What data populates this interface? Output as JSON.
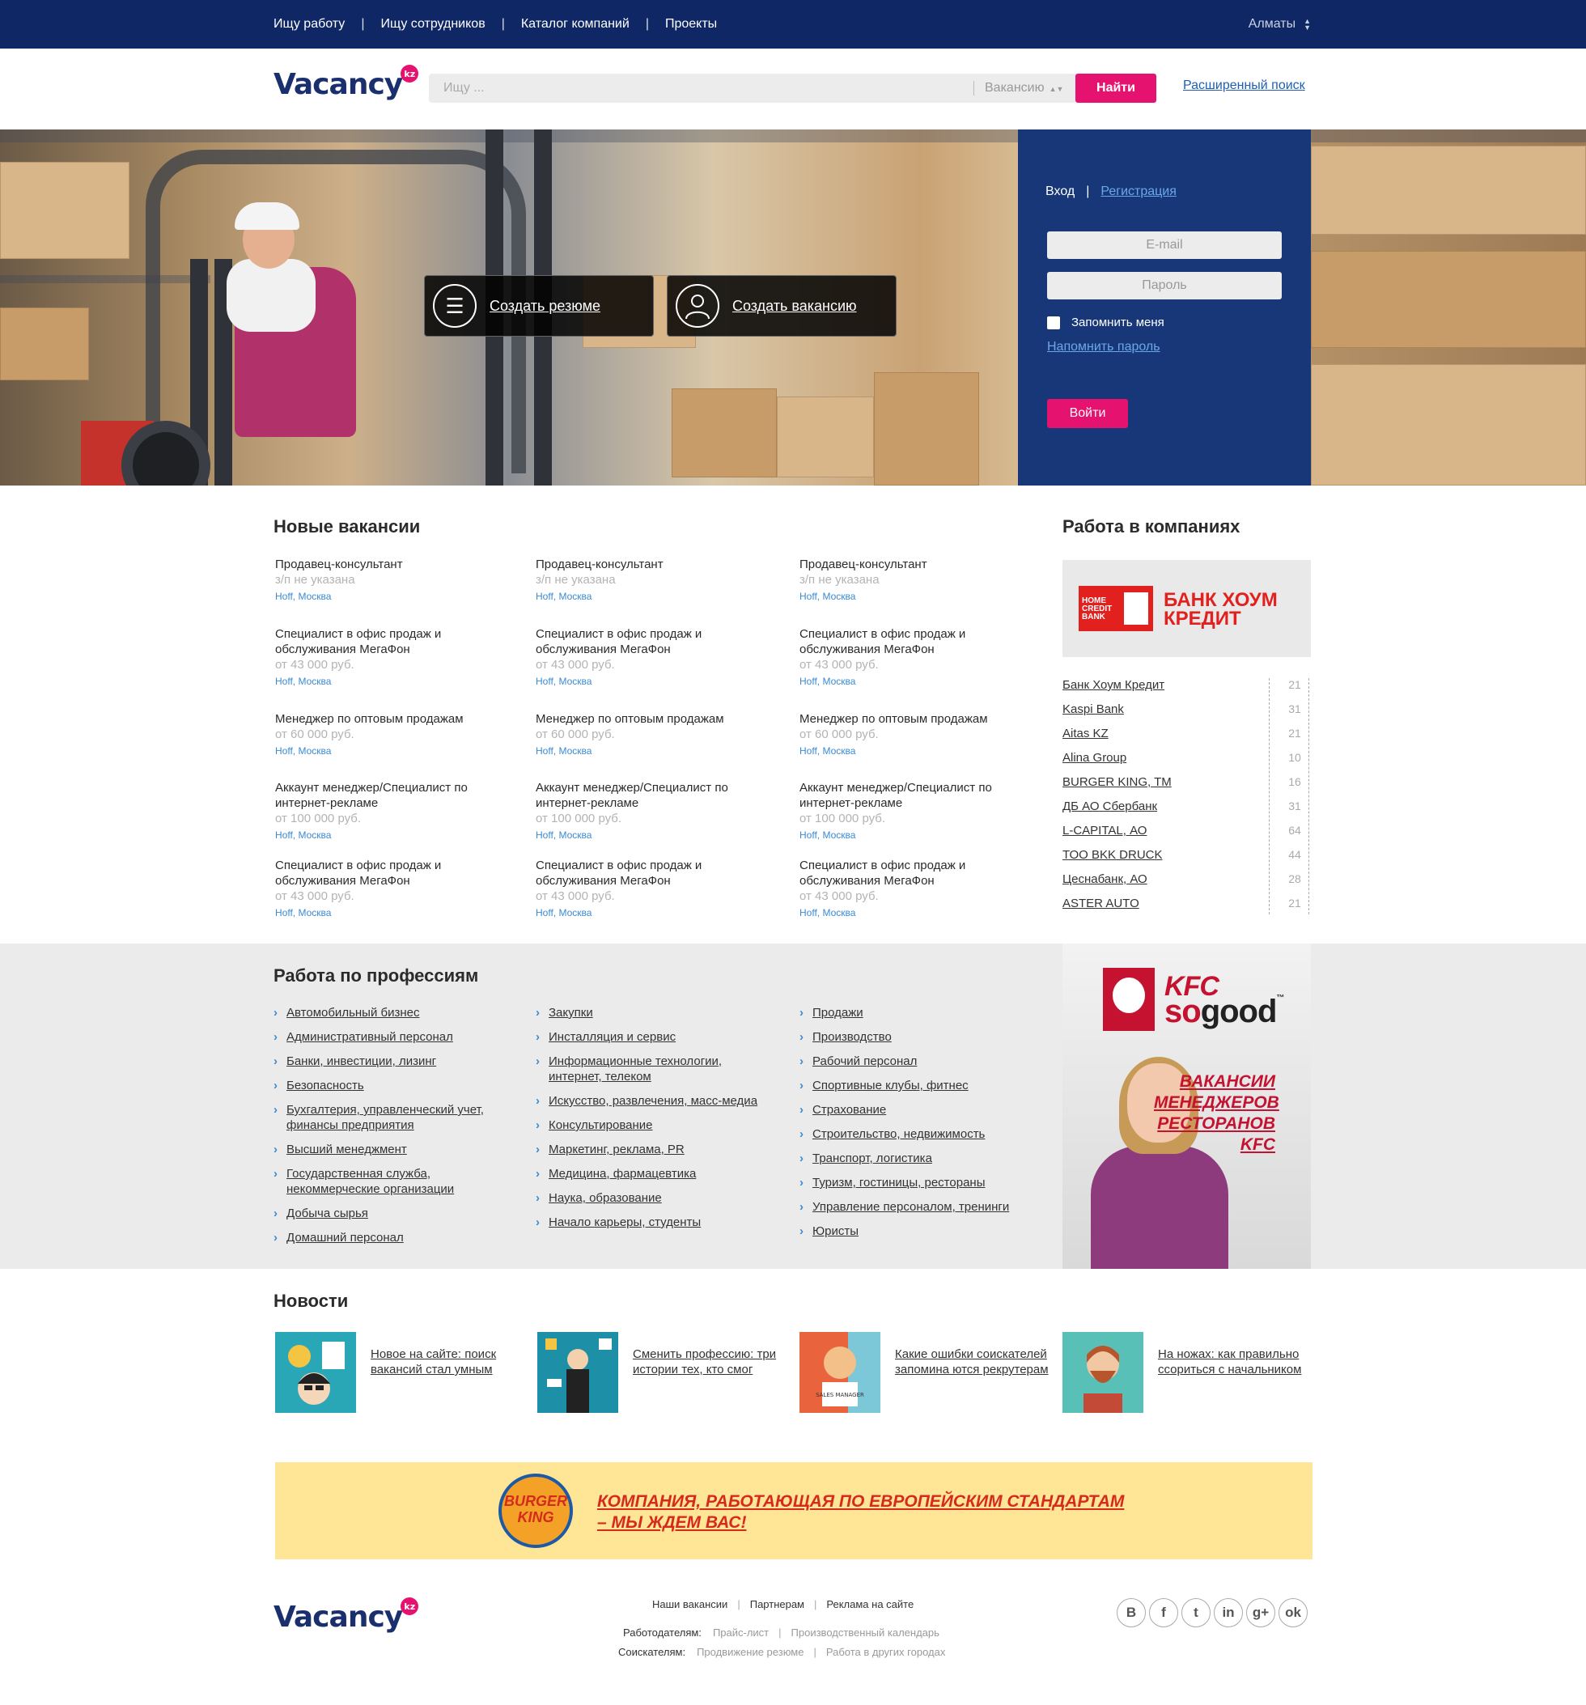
{
  "topnav": {
    "items": [
      "Ищу работу",
      "Ищу сотрудников",
      "Каталог компаний",
      "Проекты"
    ],
    "city": "Алматы"
  },
  "header": {
    "logo": "Vacancy",
    "logo_badge": "kz",
    "search_placeholder": "Ищу ...",
    "search_type": "Вакансию",
    "find_button": "Найти",
    "advanced_search": "Расширенный поиск"
  },
  "hero": {
    "create_resume": "Создать резюме",
    "create_vacancy": "Создать вакансию"
  },
  "login": {
    "tab_login": "Вход",
    "tab_register": "Регистрация",
    "email_placeholder": "E-mail",
    "password_placeholder": "Пароль",
    "remember": "Запомнить меня",
    "forgot": "Напомнить пароль",
    "submit": "Войти"
  },
  "vacancies": {
    "title": "Новые вакансии",
    "items": [
      {
        "title": "Продавец-консультант",
        "salary": "з/п не указана",
        "company": "Hoff, Москва"
      },
      {
        "title": "Продавец-консультант",
        "salary": "з/п не указана",
        "company": "Hoff, Москва"
      },
      {
        "title": "Продавец-консультант",
        "salary": "з/п не указана",
        "company": "Hoff, Москва"
      },
      {
        "title": "Специалист в офис продаж и обслуживания МегаФон",
        "salary": "от 43 000 руб.",
        "company": "Hoff, Москва"
      },
      {
        "title": "Специалист в офис продаж и обслуживания МегаФон",
        "salary": "от 43 000 руб.",
        "company": "Hoff, Москва"
      },
      {
        "title": "Специалист в офис продаж и обслуживания МегаФон",
        "salary": "от 43 000 руб.",
        "company": "Hoff, Москва"
      },
      {
        "title": "Менеджер по оптовым продажам",
        "salary": "от 60 000 руб.",
        "company": "Hoff, Москва"
      },
      {
        "title": "Менеджер по оптовым продажам",
        "salary": "от 60 000 руб.",
        "company": "Hoff, Москва"
      },
      {
        "title": "Менеджер по оптовым продажам",
        "salary": "от 60 000 руб.",
        "company": "Hoff, Москва"
      },
      {
        "title": "Аккаунт менеджер/Специалист по интернет-рекламе",
        "salary": "от 100 000 руб.",
        "company": "Hoff, Москва"
      },
      {
        "title": "Аккаунт менеджер/Специалист по интернет-рекламе",
        "salary": "от 100 000 руб.",
        "company": "Hoff, Москва"
      },
      {
        "title": "Аккаунт менеджер/Специалист по интернет-рекламе",
        "salary": "от 100 000 руб.",
        "company": "Hoff, Москва"
      },
      {
        "title": "Специалист в офис продаж и обслуживания МегаФон",
        "salary": "от 43 000 руб.",
        "company": "Hoff, Москва"
      },
      {
        "title": "Специалист в офис продаж и обслуживания МегаФон",
        "salary": "от 43 000 руб.",
        "company": "Hoff, Москва"
      },
      {
        "title": "Специалист в офис продаж и обслуживания МегаФон",
        "salary": "от 43 000 руб.",
        "company": "Hoff, Москва"
      }
    ]
  },
  "companies": {
    "title": "Работа в компаниях",
    "promo_name": "БАНК ХОУМ КРЕДИТ",
    "promo_logo_text": "HOME CREDIT BANK",
    "items": [
      {
        "name": "Банк Хоум Кредит",
        "count": "21"
      },
      {
        "name": "Kaspi Bank",
        "count": "31"
      },
      {
        "name": "Aitas KZ",
        "count": "21"
      },
      {
        "name": "Alina Group",
        "count": "10"
      },
      {
        "name": "BURGER KING, TM",
        "count": "16"
      },
      {
        "name": "ДБ АО Сбербанк",
        "count": "31"
      },
      {
        "name": "L-CAPITAL, АО",
        "count": "64"
      },
      {
        "name": "ТОО BKK DRUCK",
        "count": "44"
      },
      {
        "name": "Цеснабанк, АО",
        "count": "28"
      },
      {
        "name": "ASTER AUTO",
        "count": "21"
      }
    ]
  },
  "professions": {
    "title": "Работа по профессиям",
    "col1": [
      "Автомобильный бизнес",
      "Административный персонал",
      "Банки, инвестиции, лизинг",
      "Безопасность",
      "Бухгалтерия, управленческий учет, финансы предприятия",
      "Высший менеджмент",
      "Государственная служба, некоммерческие организации",
      "Добыча сырья",
      "Домашний персонал"
    ],
    "col2": [
      "Закупки",
      "Инсталляция и сервис",
      "Информационные технологии, интернет, телеком",
      "Искусство, развлечения, масс-медиа",
      "Консультирование",
      "Маркетинг, реклама, PR",
      "Медицина, фармацевтика",
      "Наука, образование",
      "Начало карьеры, студенты"
    ],
    "col3": [
      "Продажи",
      "Производство",
      "Рабочий персонал",
      "Спортивные клубы, фитнес",
      "Страхование",
      "Строительство, недвижимость",
      "Транспорт, логистика",
      "Туризм, гостиницы, рестораны",
      "Управление персоналом, тренинги",
      "Юристы"
    ]
  },
  "kfc_promo": {
    "brand": "KFC",
    "slogan_so": "so",
    "slogan_good": "good",
    "tm": "™",
    "text": "ВАКАНСИИ МЕНЕДЖЕРОВ РЕСТОРАНОВ KFC"
  },
  "news": {
    "title": "Новости",
    "items": [
      {
        "text": "Новое на сайте: поиск вакансий стал умным"
      },
      {
        "text": "Сменить профессию: три истории тех, кто смог"
      },
      {
        "text": "Какие ошибки соискателей запомина ются рекрутерам"
      },
      {
        "text": "На ножах: как правильно ссориться с начальником"
      }
    ],
    "image_label": "SALES MANAGER"
  },
  "bk_banner": {
    "logo_text": "BURGER KING",
    "line1": "КОМПАНИЯ, РАБОТАЮЩАЯ ПО ЕВРОПЕЙСКИМ СТАНДАРТАМ",
    "line2": "– МЫ ЖДЕМ ВАС!"
  },
  "footer": {
    "logo": "Vacancy",
    "logo_badge": "kz",
    "row1": [
      "Наши вакансии",
      "Партнерам",
      "Реклама на сайте"
    ],
    "row2_label": "Работодателям:",
    "row2": [
      "Прайс-лист",
      "Производственный календарь"
    ],
    "row3_label": "Соискателям:",
    "row3": [
      "Продвижение резюме",
      "Работа в других городах"
    ],
    "social": [
      {
        "icon": "vk-icon",
        "glyph": "B"
      },
      {
        "icon": "facebook-icon",
        "glyph": "f"
      },
      {
        "icon": "twitter-icon",
        "glyph": "t"
      },
      {
        "icon": "linkedin-icon",
        "glyph": "in"
      },
      {
        "icon": "google-plus-icon",
        "glyph": "g+"
      },
      {
        "icon": "odnoklassniki-icon",
        "glyph": "ok"
      }
    ]
  },
  "colors": {
    "nav_bg": "#0f2765",
    "accent": "#e5136f",
    "login_bg": "#173778",
    "link": "#3a8bd3"
  }
}
